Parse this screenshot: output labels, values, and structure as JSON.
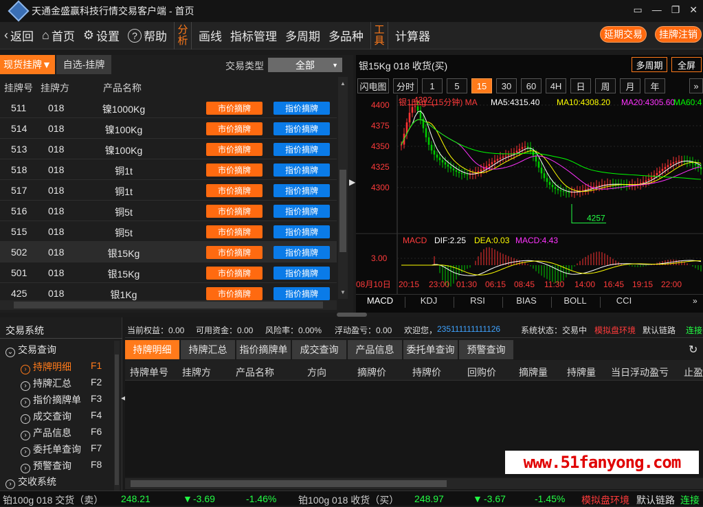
{
  "app": {
    "title": "天通金盛赢科技行情交易客户端 - 首页",
    "window_controls": [
      "▭",
      "—",
      "❐",
      "✕"
    ]
  },
  "toolbar": {
    "items": [
      {
        "icon": "‹",
        "label": "返回"
      },
      {
        "icon": "⌂",
        "label": "首页"
      },
      {
        "icon": "⚙",
        "label": "设置"
      },
      {
        "icon": "?",
        "label": "帮助"
      }
    ],
    "analysis": [
      "分",
      "析"
    ],
    "menu": [
      "画线",
      "指标管理",
      "多周期",
      "多品种"
    ],
    "tool": [
      "工",
      "具"
    ],
    "calculator": "计算器",
    "extend_trade": "延期交易",
    "listing_cancel": "挂牌注销"
  },
  "left": {
    "tab_spot": "现货挂牌▼",
    "tab_fav": "自选-挂牌",
    "trade_type_label": "交易类型",
    "trade_type_value": "全部",
    "headers": [
      "挂牌号",
      "挂牌方",
      "产品名称"
    ],
    "market_btn": "市价摘牌",
    "limit_btn": "指价摘牌",
    "rows": [
      {
        "no": "511",
        "party": "018",
        "name": "镍1000Kg"
      },
      {
        "no": "514",
        "party": "018",
        "name": "镍100Kg"
      },
      {
        "no": "513",
        "party": "018",
        "name": "镍100Kg"
      },
      {
        "no": "518",
        "party": "018",
        "name": "铜1t"
      },
      {
        "no": "517",
        "party": "018",
        "name": "铜1t"
      },
      {
        "no": "516",
        "party": "018",
        "name": "铜5t"
      },
      {
        "no": "515",
        "party": "018",
        "name": "铜5t"
      },
      {
        "no": "502",
        "party": "018",
        "name": "银15Kg"
      },
      {
        "no": "501",
        "party": "018",
        "name": "银15Kg"
      },
      {
        "no": "425",
        "party": "018",
        "name": "银1Kg"
      }
    ]
  },
  "chart": {
    "title": "银15Kg 018 收货(买)",
    "multi_period": "多周期",
    "fullscreen": "全屏",
    "timeframes": [
      "闪电图",
      "分时",
      "1",
      "5",
      "15",
      "30",
      "60",
      "4H",
      "日",
      "周",
      "月",
      "年"
    ],
    "active_tf": "15",
    "more": "»",
    "legend": {
      "name": "银15Kg",
      "period": "(15分钟) MA",
      "ma5": "MA5:4315.40",
      "ma10": "MA10:4308.20",
      "ma20": "MA20:4305.60",
      "ma60": "MA60:4"
    },
    "y_ticks": [
      "4400",
      "4375",
      "4350",
      "4325",
      "4300"
    ],
    "high_label": "4392",
    "low_label": "4257",
    "macd_legend": {
      "name": "MACD",
      "dif": "DIF:2.25",
      "dea": "DEA:0.03",
      "macd": "MACD:4.43"
    },
    "macd_tick": "3.00",
    "x_labels": [
      "08月10日",
      "20:15",
      "23:00",
      "01:30",
      "06:15",
      "08:45",
      "11:30",
      "14:00",
      "16:45",
      "19:15",
      "22:00"
    ],
    "indicators": [
      "MACD",
      "KDJ",
      "RSI",
      "BIAS",
      "BOLL",
      "CCI"
    ],
    "colors": {
      "ma5": "#ffffff",
      "ma10": "#ffff00",
      "ma20": "#ff33ff",
      "ma60": "#00ff00",
      "up": "#ff3333",
      "down": "#00cc00"
    }
  },
  "bottom": {
    "tree_title": "交易系统",
    "tree_query": "交易查询",
    "tree_items": [
      {
        "label": "持牌明细",
        "key": "F1",
        "active": true
      },
      {
        "label": "持牌汇总",
        "key": "F2"
      },
      {
        "label": "指价摘牌单",
        "key": "F3"
      },
      {
        "label": "成交查询",
        "key": "F4"
      },
      {
        "label": "产品信息",
        "key": "F6"
      },
      {
        "label": "委托单查询",
        "key": "F7"
      },
      {
        "label": "预警查询",
        "key": "F8"
      }
    ],
    "tree_exchange": "交收系统",
    "info": {
      "equity": "当前权益：0.00",
      "funds": "可用资金：0.00",
      "risk": "风险率：0.00%",
      "pnl": "浮动盈亏：0.00",
      "welcome": "欢迎您，",
      "user": "235111111111126",
      "sys_status": "系统状态：交易中",
      "sim": "模拟盘环境",
      "link": "默认链路",
      "connect": "连接"
    },
    "tabs": [
      "持牌明细",
      "持牌汇总",
      "指价摘牌单",
      "成交查询",
      "产品信息",
      "委托单查询",
      "预警查询"
    ],
    "columns": [
      "持牌单号",
      "挂牌方",
      "产品名称",
      "方向",
      "摘牌价",
      "持牌价",
      "回购价",
      "摘牌量",
      "持牌量",
      "当日浮动盈亏",
      "止盈"
    ],
    "watermark": "www.51fanyong.com"
  },
  "status": {
    "item1": "铂100g 018 交货（卖）",
    "price1": "248.21",
    "chg1": "-3.69",
    "pct1": "-1.46%",
    "item2": "铂100g 018 收货（买）",
    "price2": "248.97",
    "chg2": "-3.67",
    "pct2": "-1.45%",
    "sim": "模拟盘环境",
    "link": "默认链路",
    "connect": "连接"
  }
}
